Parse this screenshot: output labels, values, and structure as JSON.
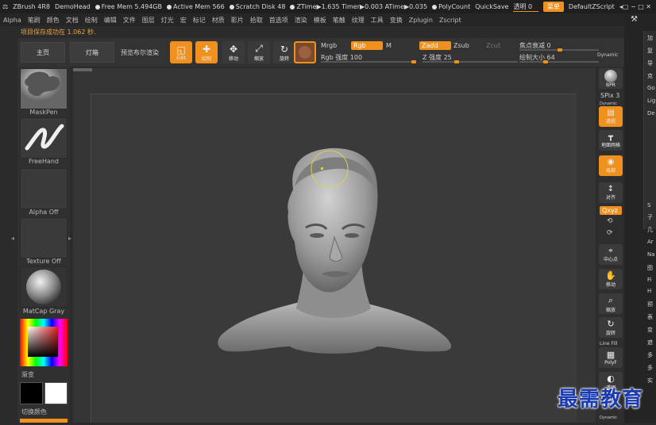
{
  "titlebar": {
    "app": "ZBrush 4R8",
    "project": "DemoHead",
    "free_mem": "Free Mem 5.494GB",
    "active_mem": "Active Mem 566",
    "scratch_disk": "Scratch Disk 48",
    "ztime": "ZTime▶1.635 Timer▶0.003 ATime▶0.035",
    "polycount": "PolyCount",
    "quicksave": "QuickSave",
    "transparency": "透明 0",
    "menu_btn": "菜单",
    "default_script": "DefaultZScript"
  },
  "menubar": [
    "Alpha",
    "笔刷",
    "颜色",
    "文档",
    "绘制",
    "编辑",
    "文件",
    "图层",
    "灯光",
    "宏",
    "标记",
    "材质",
    "影片",
    "拾取",
    "首选项",
    "渲染",
    "模板",
    "笔触",
    "纹理",
    "工具",
    "变换",
    "Zplugin",
    "Zscript"
  ],
  "notice": "项目保存成功在 1.062 秒.",
  "toolbar": {
    "home": "主页",
    "lightbox": "灯箱",
    "bpr": "预览布尔渲染",
    "edit": "Edit",
    "draw": "绘制",
    "move": "移动",
    "scale": "缩放",
    "rotate": "旋转",
    "mrgb": "Mrgb",
    "rgb": "Rgb",
    "m": "M",
    "rgb_intensity": "Rgb 强度 100",
    "zadd": "Zadd",
    "zsub": "Zsub",
    "zcut": "Zcut",
    "z_intensity": "Z 强度 25",
    "focal_shift": "焦点衰减 0",
    "draw_size": "绘制大小 64",
    "dynamic": "Dynamic"
  },
  "leftpanel": {
    "brush": "MaskPen",
    "stroke": "FreeHand",
    "alpha": "Alpha Off",
    "texture": "Texture Off",
    "material": "MatCap Gray",
    "gradient": "渐变",
    "switch_color": "切换颜色"
  },
  "rightshelf": {
    "bpr": "BPR",
    "spix": "SPix 3",
    "dynamic": "Dynamic",
    "persp": "透视",
    "floor": "地面网格",
    "local": "局部",
    "frame": "对齐",
    "xyz": "Qxyz",
    "center": "中心点",
    "move": "移动",
    "zoom": "缩放",
    "rotate": "旋转",
    "linefill": "Line Fill",
    "polyf": "PolyF",
    "transp": "透明",
    "dynamic2": "Dynamic"
  },
  "sidetray": [
    "加",
    "复",
    "导",
    "克",
    "Go",
    "Lig",
    "De",
    "S",
    "子",
    "几",
    "Ar",
    "Na",
    "图",
    "Fi",
    "H",
    "预",
    "表",
    "变",
    "遮",
    "多",
    "多",
    "实"
  ],
  "watermark": "最需教育",
  "colors": {
    "accent": "#f0901e",
    "background": "#2b2b2b",
    "watermark": "#1a3bb0"
  }
}
